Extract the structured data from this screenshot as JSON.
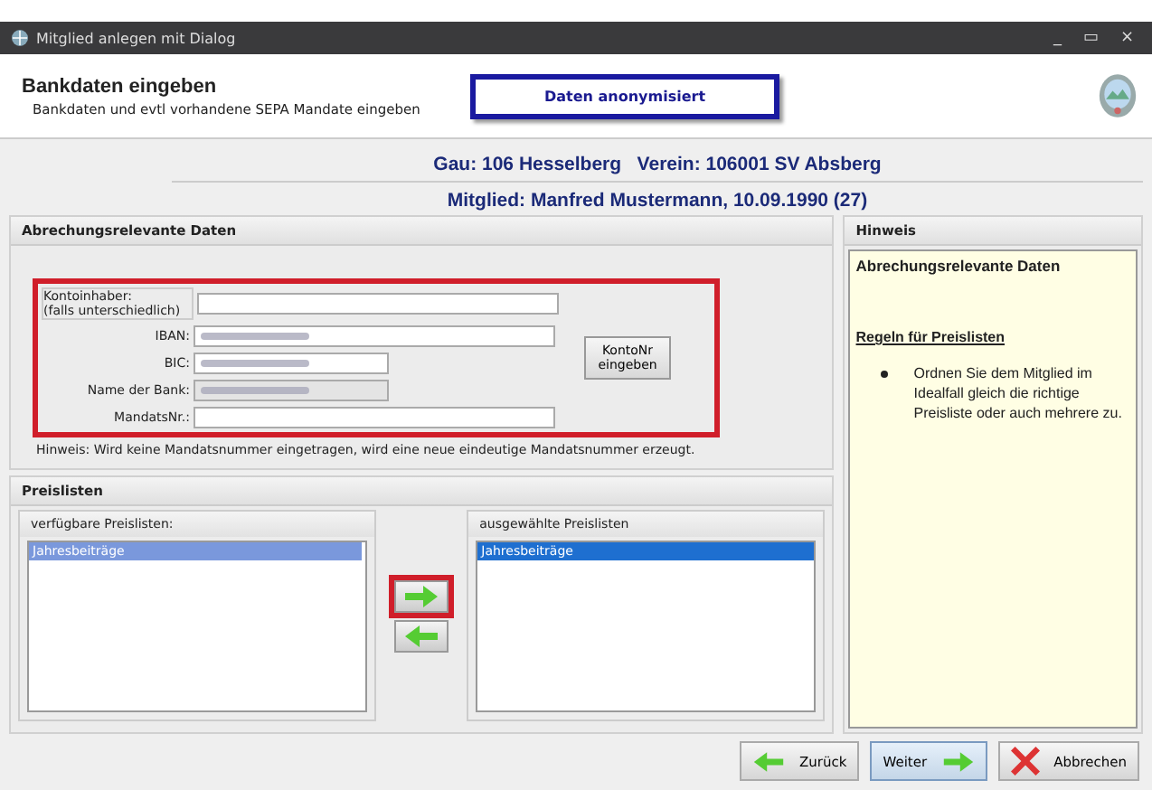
{
  "window": {
    "title": "Mitglied anlegen mit Dialog",
    "controls": [
      "_",
      "▭",
      "×"
    ]
  },
  "header": {
    "title": "Bankdaten eingeben",
    "subtitle": "Bankdaten und evtl vorhandene SEPA Mandate eingeben",
    "badge": "Daten anonymisiert"
  },
  "info": {
    "line_1": "Gau: 106 Hesselberg   Verein: 106001 SV Absberg",
    "line_2": "Mitglied: Manfred Mustermann, 10.09.1990 (27)"
  },
  "billing": {
    "title": "Abrechungsrelevante Daten",
    "highlighted": true,
    "fields": [
      {
        "label": "Kontoinhaber:",
        "sublabel": "(falls unterschiedlich)",
        "kind": "wide",
        "redacted": false,
        "disabled": false
      },
      {
        "label": "IBAN:",
        "kind": "wide",
        "redacted": true,
        "disabled": false
      },
      {
        "label": "BIC:",
        "kind": "short",
        "redacted": true,
        "disabled": false
      },
      {
        "label": "Name der Bank:",
        "kind": "short",
        "redacted": true,
        "disabled": true
      },
      {
        "label": "MandatsNr.:",
        "kind": "wide",
        "redacted": false,
        "disabled": false
      }
    ],
    "button": "KontoNr eingeben",
    "hint": "Hinweis: Wird keine Mandatsnummer eingetragen, wird eine neue eindeutige Mandatsnummer erzeugt."
  },
  "price_lists": {
    "title": "Preislisten",
    "available": {
      "title": "verfügbare Preislisten:",
      "items": [
        {
          "label": "Jahresbeiträge",
          "selected": true
        }
      ]
    },
    "chosen": {
      "title": "ausgewählte Preislisten",
      "items": [
        {
          "label": "Jahresbeiträge",
          "selected": true
        }
      ]
    },
    "move_buttons": [
      {
        "kind": "right",
        "highlighted": true
      },
      {
        "kind": "left",
        "highlighted": false
      }
    ]
  },
  "hint_panel": {
    "title": "Hinweis",
    "heading": "Abrechungsrelevante Daten",
    "subheading": "Regeln für Preislisten",
    "bullets": [
      "Ordnen Sie dem Mitglied im Idealfall gleich die richtige Preisliste oder auch mehrere zu."
    ]
  },
  "buttons": [
    {
      "kind": "back",
      "label": "Zurück",
      "focused": false
    },
    {
      "kind": "next",
      "label": "Weiter",
      "focused": true
    },
    {
      "kind": "cancel",
      "label": "Abbrechen",
      "focused": false
    }
  ]
}
